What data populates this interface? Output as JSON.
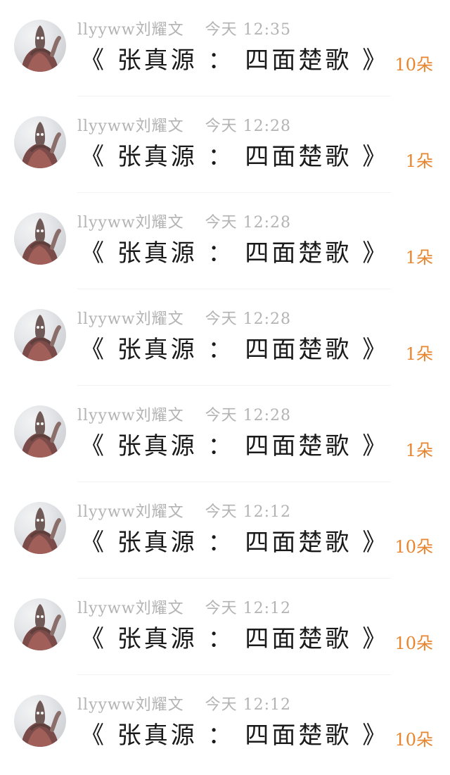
{
  "rows": [
    {
      "username": "llyyww刘耀文",
      "time": "今天 12:35",
      "title": "《 张真源 ： 四面楚歌 》",
      "count": "10朵"
    },
    {
      "username": "llyyww刘耀文",
      "time": "今天 12:28",
      "title": "《 张真源 ： 四面楚歌 》",
      "count": "1朵"
    },
    {
      "username": "llyyww刘耀文",
      "time": "今天 12:28",
      "title": "《 张真源 ： 四面楚歌 》",
      "count": "1朵"
    },
    {
      "username": "llyyww刘耀文",
      "time": "今天 12:28",
      "title": "《 张真源 ： 四面楚歌 》",
      "count": "1朵"
    },
    {
      "username": "llyyww刘耀文",
      "time": "今天 12:28",
      "title": "《 张真源 ： 四面楚歌 》",
      "count": "1朵"
    },
    {
      "username": "llyyww刘耀文",
      "time": "今天 12:12",
      "title": "《 张真源 ： 四面楚歌 》",
      "count": "10朵"
    },
    {
      "username": "llyyww刘耀文",
      "time": "今天 12:12",
      "title": "《 张真源 ： 四面楚歌 》",
      "count": "10朵"
    },
    {
      "username": "llyyww刘耀文",
      "time": "今天 12:12",
      "title": "《 张真源 ： 四面楚歌 》",
      "count": "10朵"
    }
  ],
  "colors": {
    "meta": "#b3b3b3",
    "title": "#1a1a1a",
    "count": "#e7862f",
    "divider": "#f2f2f2"
  },
  "icons": {
    "avatar": "avatar"
  }
}
